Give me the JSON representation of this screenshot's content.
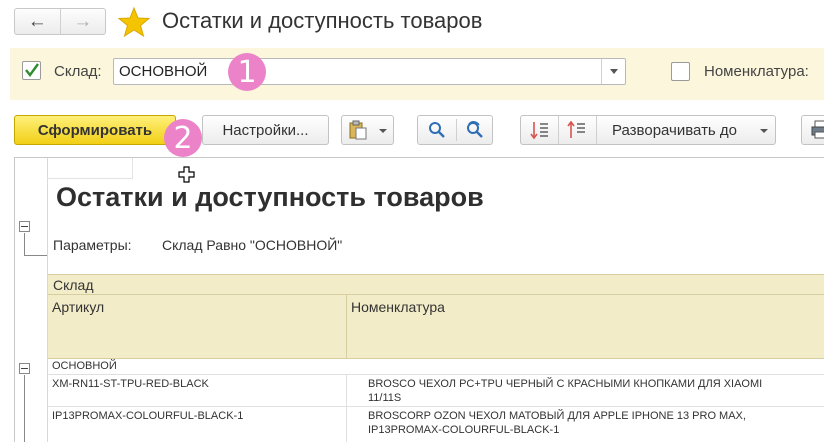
{
  "window": {
    "title": "Остатки и доступность товаров",
    "back_icon": "arrow-left-icon",
    "forward_icon": "arrow-right-icon",
    "favorite_icon": "star-icon",
    "favorite_color": "#f5c400"
  },
  "filters": {
    "warehouse_label": "Склад:",
    "warehouse_checked": true,
    "warehouse_value": "ОСНОВНОЙ",
    "nomenclature_label": "Номенклатура:",
    "nomenclature_checked": false,
    "badge1": "1"
  },
  "toolbar": {
    "generate_label": "Сформировать",
    "settings_label": "Настройки...",
    "expand_label": "Разворачивать до",
    "badge2": "2",
    "accent_color": "#f1cf16"
  },
  "report": {
    "title": "Остатки и доступность товаров",
    "params_label": "Параметры:",
    "params_value": "Склад Равно \"ОСНОВНОЙ\"",
    "header_group": "Склад",
    "col_article": "Артикул",
    "col_nomenclature": "Номенклатура",
    "group_name": "ОСНОВНОЙ",
    "rows": [
      {
        "article": "XM-RN11-ST-TPU-RED-BLACK",
        "name": "BROSCO ЧЕХОЛ PC+TPU ЧЕРНЫЙ С КРАСНЫМИ КНОПКАМИ ДЛЯ XIAOMI\n11/11S"
      },
      {
        "article": "IP13PROMAX-COLOURFUL-BLACK-1",
        "name": "BROSCORP OZON ЧЕХОЛ МАТОВЫЙ ДЛЯ APPLE IPHONE 13 PRO MAX,\nIP13PROMAX-COLOURFUL-BLACK-1"
      }
    ]
  },
  "badge_color": "#ec83c8"
}
